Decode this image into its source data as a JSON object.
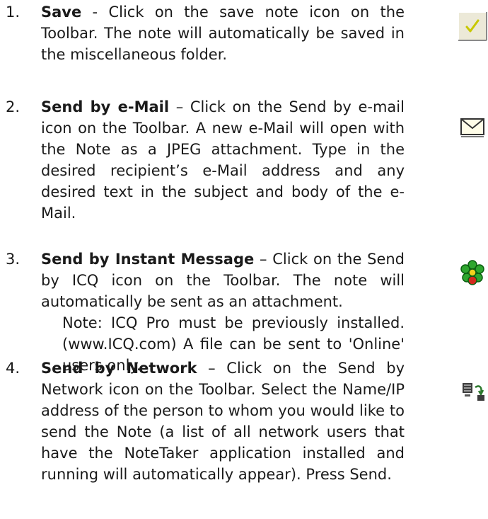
{
  "items": [
    {
      "number": "1.",
      "title": "Save",
      "separator": " - ",
      "body": "Click on the save note icon on the Toolbar. The note will automatically be saved in the miscellaneous folder.",
      "icon": "save-check-icon"
    },
    {
      "number": "2.",
      "title": "Send by e-Mail",
      "separator": " – ",
      "body": "Click on the Send by e-mail icon on the Toolbar. A new e-Mail will open with the Note as a JPEG attachment. Type in the desired recipient’s e-Mail address and any desired text in the subject and body of the e-Mail.",
      "icon": "envelope-icon"
    },
    {
      "number": "3.",
      "title": "Send by Instant Message",
      "separator": " – ",
      "body": "Click on the Send by ICQ icon on the Toolbar. The note will automatically be sent as an attachment.",
      "note": "Note: ICQ Pro must be previously installed. (www.ICQ.com) A file can be sent to 'Online' users only.",
      "icon": "icq-flower-icon"
    },
    {
      "number": "4.",
      "title": "Send by Network",
      "separator": " – ",
      "body": "Click on the Send by Network icon on the Toolbar. Select the Name/IP address of the person to whom you would like to send the Note (a list of all network users that have the NoteTaker application installed and running will automatically appear). Press Send.",
      "icon": "network-send-icon"
    }
  ]
}
